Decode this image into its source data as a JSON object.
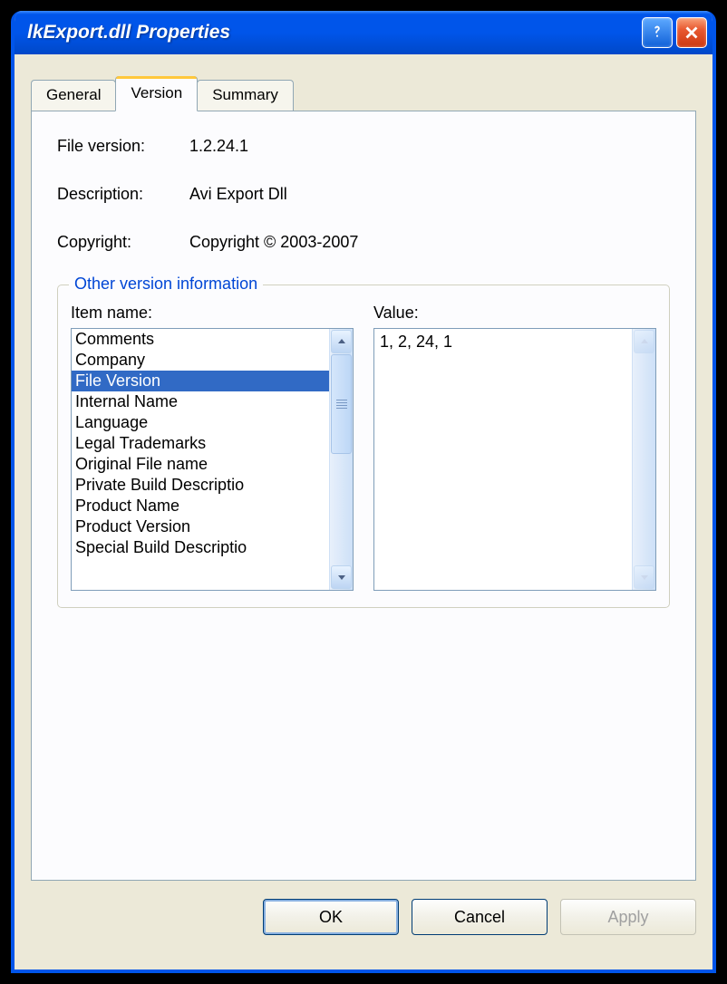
{
  "window": {
    "title": "lkExport.dll Properties"
  },
  "tabs": {
    "general": "General",
    "version": "Version",
    "summary": "Summary"
  },
  "info": {
    "file_version_label": "File version:",
    "file_version_value": "1.2.24.1",
    "description_label": "Description:",
    "description_value": "Avi Export Dll",
    "copyright_label": "Copyright:",
    "copyright_value": "Copyright © 2003-2007"
  },
  "group": {
    "title": "Other version information",
    "item_name_label": "Item name:",
    "value_label": "Value:",
    "items": {
      "i0": "Comments",
      "i1": "Company",
      "i2": "File Version",
      "i3": "Internal Name",
      "i4": "Language",
      "i5": "Legal Trademarks",
      "i6": "Original File name",
      "i7": "Private Build Descriptio",
      "i8": "Product Name",
      "i9": "Product Version",
      "i10": "Special Build Descriptio"
    },
    "selected_value": "1, 2, 24, 1"
  },
  "buttons": {
    "ok": "OK",
    "cancel": "Cancel",
    "apply": "Apply"
  }
}
